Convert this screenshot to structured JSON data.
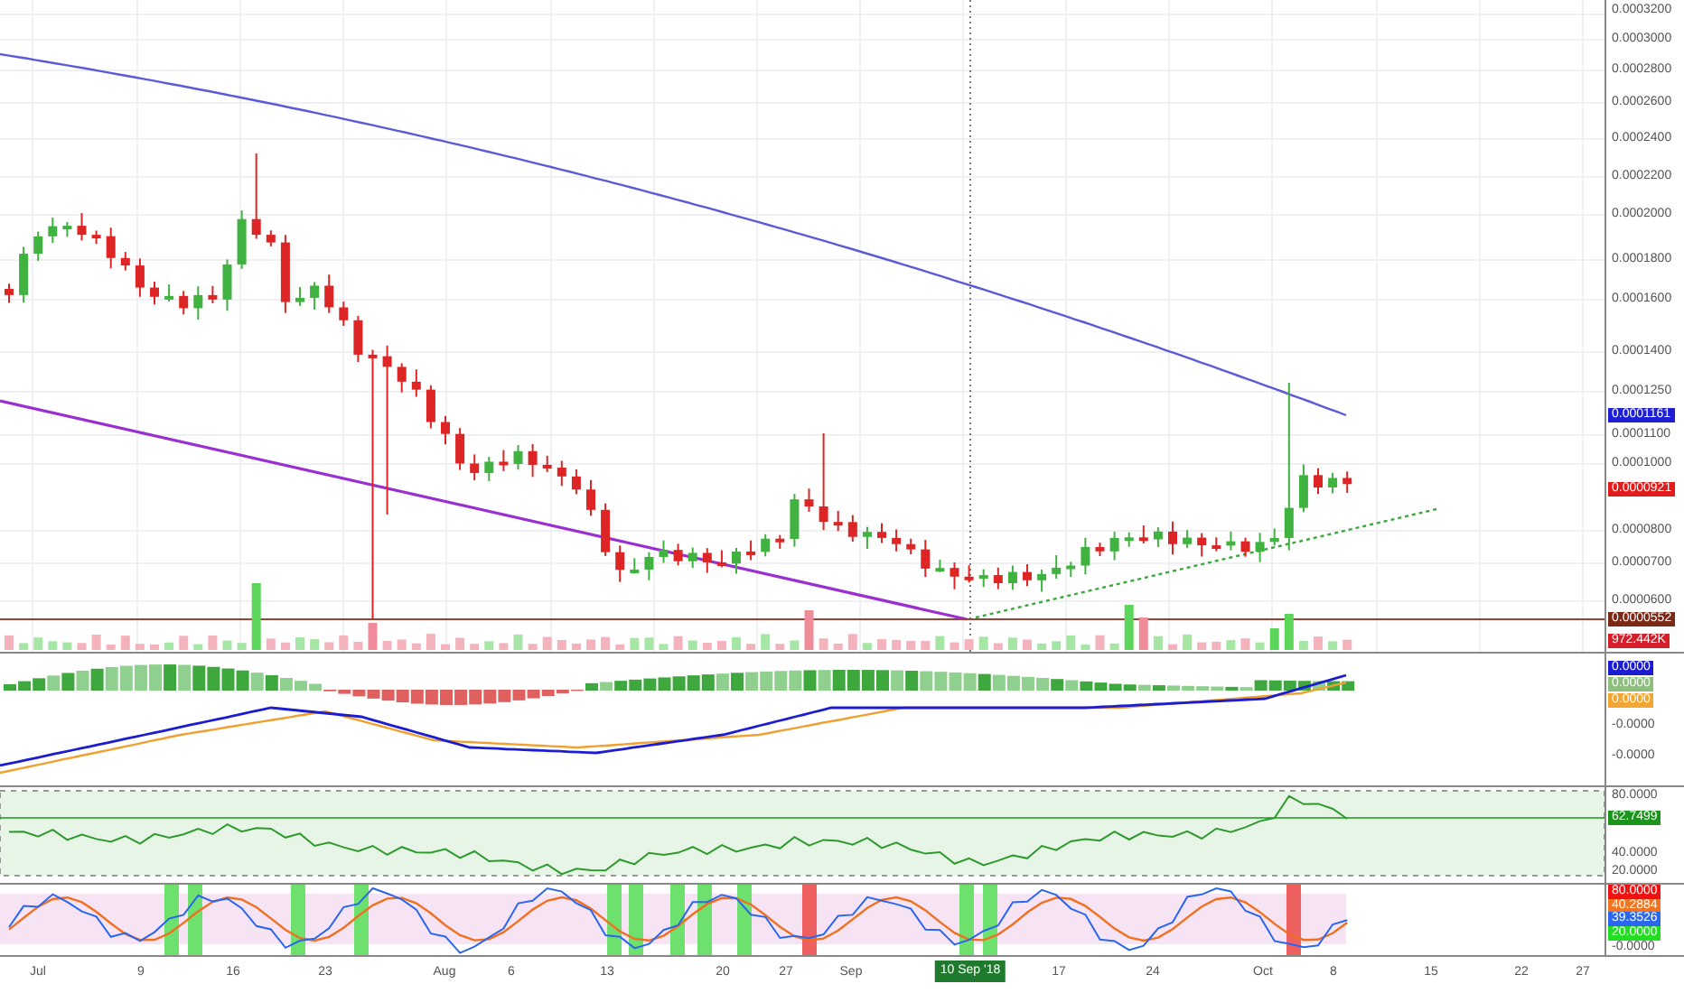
{
  "price_axis": {
    "labels": [
      "0.0003200",
      "0.0003000",
      "0.0002800",
      "0.0002600",
      "0.0002400",
      "0.0002200",
      "0.0002000",
      "0.0001800",
      "0.0001600",
      "0.0001400",
      "0.0001250",
      "0.0001100",
      "0.0001000",
      "0.0000800",
      "0.0000700",
      "0.0000600"
    ],
    "tags": [
      {
        "text": "0.0001161",
        "color": "#1f1fd8"
      },
      {
        "text": "0.0000921",
        "color": "#e21b1b"
      },
      {
        "text": "0.0000552",
        "color": "#7a2a16"
      },
      {
        "text": "972.442K",
        "color": "#d41f2a"
      }
    ]
  },
  "macd_axis": {
    "tags": [
      {
        "text": "0.0000",
        "color": "#1c1cd0"
      },
      {
        "text": "0.0000",
        "color": "#8fbf7f"
      },
      {
        "text": "0.0000",
        "color": "#f2a531"
      }
    ],
    "labels": [
      "-0.0000",
      "-0.0000"
    ]
  },
  "rsi_axis": {
    "labels": [
      "80.0000",
      "40.0000",
      "20.0000"
    ],
    "tags": [
      {
        "text": "62.7499",
        "color": "#1a941a"
      }
    ]
  },
  "stochastic_axis": {
    "tags": [
      {
        "text": "80.0000",
        "color": "#f01212"
      },
      {
        "text": "40.2884",
        "color": "#f27320"
      },
      {
        "text": "39.3526",
        "color": "#2a66ee"
      },
      {
        "text": "20.0000",
        "color": "#22dd22"
      }
    ],
    "labels": [
      "-0.0000"
    ]
  },
  "time_axis": {
    "labels": [
      "Jul",
      "9",
      "16",
      "23",
      "Aug",
      "6",
      "13",
      "20",
      "27",
      "Sep",
      "17",
      "24",
      "Oct",
      "8",
      "15",
      "22",
      "27"
    ],
    "crosshair_label": "10 Sep '18"
  }
}
